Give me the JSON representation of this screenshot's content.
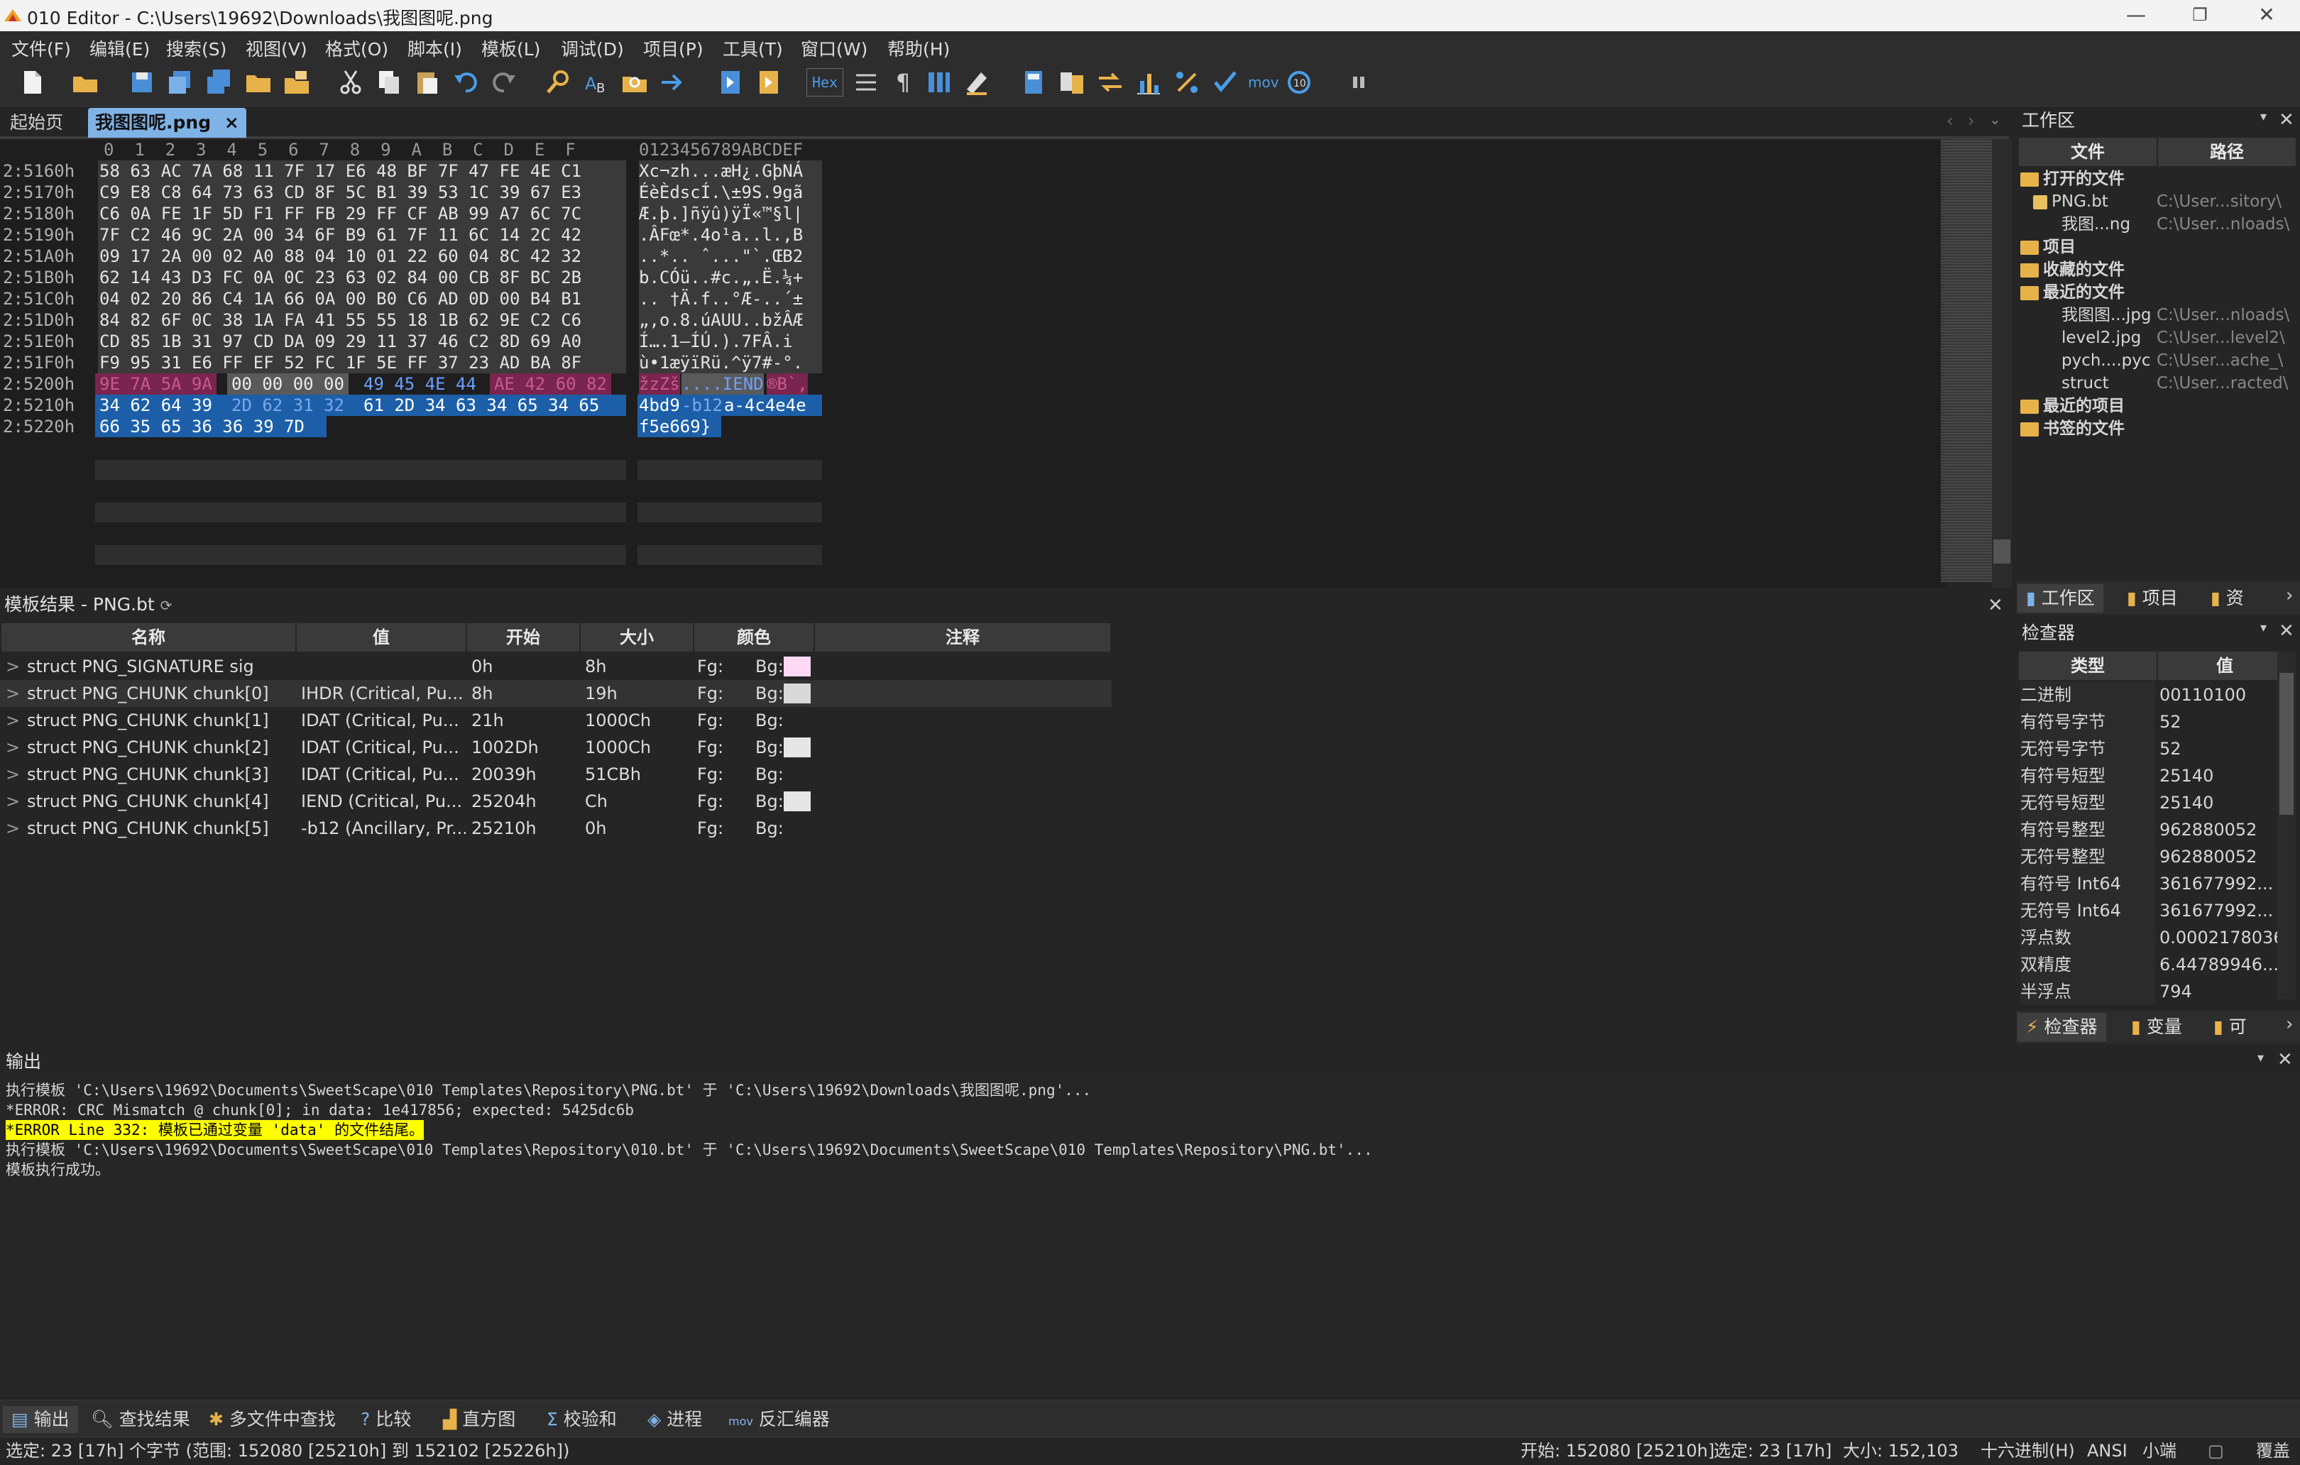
{
  "window": {
    "title": "010 Editor - C:\\Users\\19692\\Downloads\\我图图呢.png",
    "minimize": "—",
    "maximize": "❐",
    "close": "✕"
  },
  "menu": [
    "文件(F)",
    "编辑(E)",
    "搜索(S)",
    "视图(V)",
    "格式(O)",
    "脚本(I)",
    "模板(L)",
    "调试(D)",
    "项目(P)",
    "工具(T)",
    "窗口(W)",
    "帮助(H)"
  ],
  "toolbar": {
    "hex_label": "Hex",
    "mov_label": "mov",
    "pilcrow": "¶"
  },
  "tabs": {
    "start": "起始页",
    "file": "我图图呢.png",
    "close": "×"
  },
  "hex": {
    "header_hex": "0  1  2  3  4  5  6  7  8  9  A  B  C  D  E  F",
    "header_text": "0123456789ABCDEF",
    "offsets": [
      "2:5160h",
      "2:5170h",
      "2:5180h",
      "2:5190h",
      "2:51A0h",
      "2:51B0h",
      "2:51C0h",
      "2:51D0h",
      "2:51E0h",
      "2:51F0h",
      "2:5200h",
      "2:5210h",
      "2:5220h"
    ],
    "rows": [
      "58 63 AC 7A 68 11 7F 17 E6 48 BF 7F 47 FE 4E C1",
      "C9 E8 C8 64 73 63 CD 8F 5C B1 39 53 1C 39 67 E3",
      "C6 0A FE 1F 5D F1 FF FB 29 FF CF AB 99 A7 6C 7C",
      "7F C2 46 9C 2A 00 34 6F B9 61 7F 11 6C 14 2C 42",
      "09 17 2A 00 02 A0 88 04 10 01 22 60 04 8C 42 32",
      "62 14 43 D3 FC 0A 0C 23 63 02 84 00 CB 8F BC 2B",
      "04 02 20 86 C4 1A 66 0A 00 B0 C6 AD 0D 00 B4 B1",
      "84 82 6F 0C 38 1A FA 41 55 55 18 1B 62 9E C2 C6",
      "CD 85 1B 31 97 CD DA 09 29 11 37 46 C2 8D 69 A0",
      "F9 95 31 E6 FF EF 52 FC 1F 5E FF 37 23 AD BA 8F"
    ],
    "text_rows": [
      "Xc¬zh...æH¿.GþNÁ",
      "ÉèÈdscÍ.\\±9S.9gã",
      "Æ.þ.]ñÿû)ÿÏ«™§l|",
      ".ÂFœ*.4o¹a..l.,B",
      "..*.. ˆ...\"`.ŒB2",
      "b.CÓü..#c.„.Ë.¼+",
      ".. †Ä.f..°Æ-..´±",
      "„‚o.8.úAUU..bžÂÆ",
      "Í….1—ÍÚ.).7FÂ.i ",
      "ù•1æÿïRü.^ÿ7#-°."
    ],
    "row_5200": {
      "crc_bytes": "9E 7A 5A 9A",
      "len_bytes": "00 00 00 00",
      "type_bytes": "49 45 4E 44",
      "crc2_bytes": "AE 42 60 82",
      "text_a": "žzZš",
      "text_b": "....IEND",
      "text_c": "®B`‚"
    },
    "row_5210": {
      "a": "34 62 64 39",
      "b": "2D 62 31 32",
      "c": "61 2D 34 63 34 65 34 65",
      "text_a": "4bd9",
      "text_b": "-b12",
      "text_c": "a-4c4e4e"
    },
    "row_5220": {
      "a": "66 35 65 36 36 39 7D",
      "text": "f5e669}"
    }
  },
  "workspace": {
    "title": "工作区",
    "col_file": "文件",
    "col_path": "路径",
    "open_files": "打开的文件",
    "items": [
      {
        "name": "PNG.bt",
        "path": "C:\\User...sitory\\"
      },
      {
        "name": "我图...ng",
        "path": "C:\\User...nloads\\"
      }
    ],
    "projects": "项目",
    "favorites": "收藏的文件",
    "recent_files": "最近的文件",
    "recent": [
      {
        "name": "我图图...jpg",
        "path": "C:\\User...nloads\\"
      },
      {
        "name": "level2.jpg",
        "path": "C:\\User...level2\\"
      },
      {
        "name": "pych....pyc",
        "path": "C:\\User...ache_\\"
      },
      {
        "name": "struct",
        "path": "C:\\User...racted\\"
      }
    ],
    "recent_projects": "最近的项目",
    "bookmarks": "书签的文件",
    "tabs": [
      "工作区",
      "项目",
      "资"
    ]
  },
  "template": {
    "title": "模板结果 - PNG.bt",
    "columns": [
      "名称",
      "值",
      "开始",
      "大小",
      "颜色",
      "注释"
    ],
    "rows": [
      {
        "name": "struct PNG_SIGNATURE sig",
        "value": "",
        "start": "0h",
        "size": "8h",
        "fg": "Fg:",
        "bg": "Bg:",
        "bgcolor": "#ffd9f4"
      },
      {
        "name": "struct PNG_CHUNK chunk[0]",
        "value": "IHDR  (Critical, Pu...",
        "start": "8h",
        "size": "19h",
        "fg": "Fg:",
        "bg": "Bg:",
        "bgcolor": "#d9d9d9"
      },
      {
        "name": "struct PNG_CHUNK chunk[1]",
        "value": "IDAT  (Critical, Pu...",
        "start": "21h",
        "size": "1000Ch",
        "fg": "Fg:",
        "bg": "Bg:",
        "bgcolor": ""
      },
      {
        "name": "struct PNG_CHUNK chunk[2]",
        "value": "IDAT  (Critical, Pu...",
        "start": "1002Dh",
        "size": "1000Ch",
        "fg": "Fg:",
        "bg": "Bg:",
        "bgcolor": "#e6e6e6"
      },
      {
        "name": "struct PNG_CHUNK chunk[3]",
        "value": "IDAT  (Critical, Pu...",
        "start": "20039h",
        "size": "51CBh",
        "fg": "Fg:",
        "bg": "Bg:",
        "bgcolor": ""
      },
      {
        "name": "struct PNG_CHUNK chunk[4]",
        "value": "IEND  (Critical, Pu...",
        "start": "25204h",
        "size": "Ch",
        "fg": "Fg:",
        "bg": "Bg:",
        "bgcolor": "#e6e6e6"
      },
      {
        "name": "struct PNG_CHUNK chunk[5]",
        "value": "-b12  (Ancillary, Pr...",
        "start": "25210h",
        "size": "0h",
        "fg": "Fg:",
        "bg": "Bg:",
        "bgcolor": ""
      }
    ]
  },
  "inspector": {
    "title": "检查器",
    "col_type": "类型",
    "col_value": "值",
    "rows": [
      {
        "type": "二进制",
        "value": "00110100"
      },
      {
        "type": "有符号字节",
        "value": "52"
      },
      {
        "type": "无符号字节",
        "value": "52"
      },
      {
        "type": "有符号短型",
        "value": "25140"
      },
      {
        "type": "无符号短型",
        "value": "25140"
      },
      {
        "type": "有符号整型",
        "value": "962880052"
      },
      {
        "type": "无符号整型",
        "value": "962880052"
      },
      {
        "type": "有符号 Int64",
        "value": "361677992..."
      },
      {
        "type": "无符号 Int64",
        "value": "361677992..."
      },
      {
        "type": "浮点数",
        "value": "0.0002178036"
      },
      {
        "type": "双精度",
        "value": "6.44789946..."
      },
      {
        "type": "半浮点",
        "value": "794"
      }
    ],
    "tabs": [
      "检查器",
      "变量",
      "可"
    ]
  },
  "output": {
    "title": "输出",
    "lines": [
      "执行模板 'C:\\Users\\19692\\Documents\\SweetScape\\010 Templates\\Repository\\PNG.bt' 于 'C:\\Users\\19692\\Downloads\\我图图呢.png'...",
      "*ERROR: CRC Mismatch @ chunk[0]; in data: 1e417856; expected: 5425dc6b",
      "*ERROR Line 332: 模板已通过变量 'data' 的文件结尾。",
      "执行模板 'C:\\Users\\19692\\Documents\\SweetScape\\010 Templates\\Repository\\010.bt' 于 'C:\\Users\\19692\\Documents\\SweetScape\\010 Templates\\Repository\\PNG.bt'...",
      "模板执行成功。"
    ]
  },
  "bottom_tabs": [
    "输出",
    "查找结果",
    "多文件中查找",
    "比较",
    "直方图",
    "校验和",
    "进程",
    "反汇编器"
  ],
  "status": {
    "left": "选定: 23 [17h] 个字节 (范围: 152080 [25210h] 到 152102 [25226h])",
    "start": "开始: 152080 [25210h]",
    "sel": "选定: 23 [17h]",
    "size": "大小: 152,103",
    "mode": "十六进制(H)",
    "enc": "ANSI",
    "endian": "小端",
    "ovr": "覆盖"
  },
  "colors": {
    "selection": "#264f78",
    "selection_strong": "#1c5fa8",
    "pink": "#9b2d5c",
    "ihdr_gray": "#5a5a5a",
    "error_highlight": "#ffff00"
  }
}
